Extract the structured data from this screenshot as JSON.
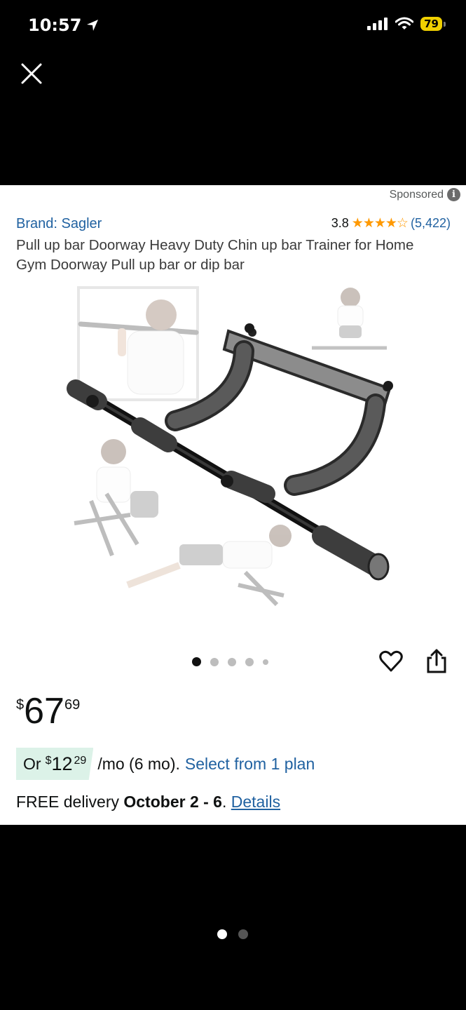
{
  "status_bar": {
    "time": "10:57",
    "battery": "79"
  },
  "card": {
    "sponsored_label": "Sponsored",
    "brand": "Brand: Sagler",
    "rating": "3.8",
    "stars_value": 3.8,
    "stars_max": 5,
    "review_count": "(5,422)",
    "title": "Pull up bar Doorway Heavy Duty Chin up bar Trainer for Home Gym Doorway Pull up bar or dip bar",
    "image_carousel": {
      "total": 5,
      "active": 1
    },
    "price": {
      "symbol": "$",
      "whole": "67",
      "fraction": "69"
    },
    "installment": {
      "or_label": "Or",
      "symbol": "$",
      "whole": "12",
      "fraction": "29",
      "terms": "/mo (6 mo).",
      "select_label": "Select from 1 plan"
    },
    "delivery": {
      "prefix": "FREE delivery",
      "dates": "October 2 - 6",
      "suffix": ".",
      "details_label": "Details"
    }
  },
  "page_indicator": {
    "total": 2,
    "active": 1
  },
  "colors": {
    "link": "#2162a1",
    "star": "#ff9900",
    "installment_bg": "#dcf2e8",
    "battery": "#f0d000"
  }
}
